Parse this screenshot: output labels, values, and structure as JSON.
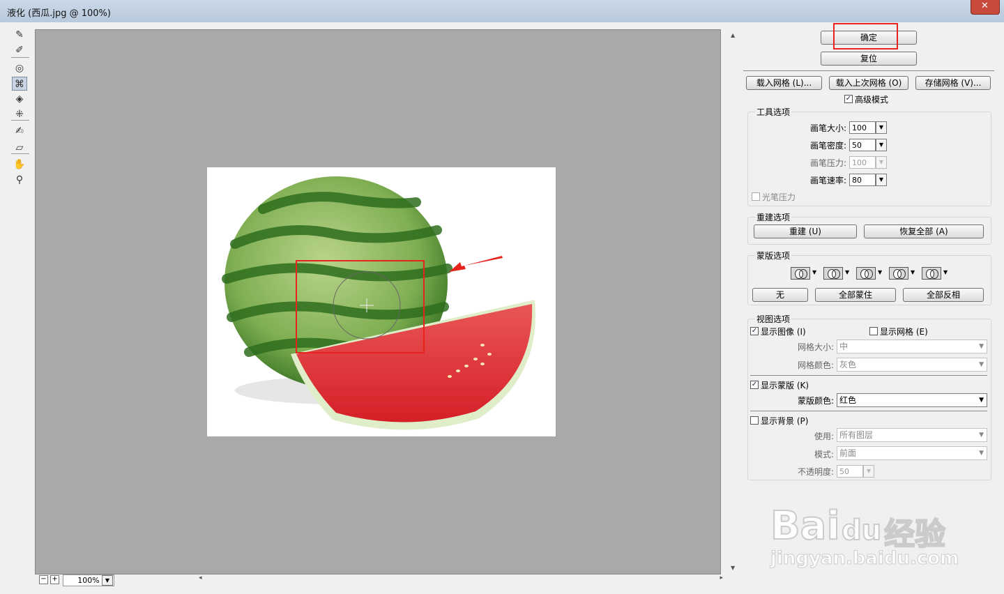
{
  "window": {
    "title": "液化 (西瓜.jpg @ 100%)",
    "close_glyph": "✕"
  },
  "tools": [
    {
      "name": "forward-warp-tool-icon",
      "glyph": "✎"
    },
    {
      "name": "reconstruct-tool-icon",
      "glyph": "✐"
    },
    {
      "name": "twirl-tool-icon",
      "glyph": "◎"
    },
    {
      "name": "pucker-tool-icon",
      "glyph": "⌘"
    },
    {
      "name": "bloat-tool-icon",
      "glyph": "◈"
    },
    {
      "name": "push-left-tool-icon",
      "glyph": "⁜"
    },
    {
      "name": "freeze-mask-tool-icon",
      "glyph": "✍"
    },
    {
      "name": "thaw-mask-tool-icon",
      "glyph": "▱"
    },
    {
      "name": "hand-tool-icon",
      "glyph": "✋"
    },
    {
      "name": "zoom-tool-icon",
      "glyph": "⚲"
    }
  ],
  "status": {
    "zoom": "100%",
    "zoom_out": "−",
    "zoom_in": "+"
  },
  "buttons": {
    "ok": "确定",
    "reset": "复位",
    "load_mesh": "载入网格 (L)...",
    "load_last_mesh": "载入上次网格 (O)",
    "save_mesh": "存储网格 (V)..."
  },
  "advanced_mode": {
    "label": "高级模式",
    "checked": true
  },
  "tool_options": {
    "title": "工具选项",
    "brush_size": {
      "label": "画笔大小:",
      "value": "100"
    },
    "brush_density": {
      "label": "画笔密度:",
      "value": "50"
    },
    "brush_pressure": {
      "label": "画笔压力:",
      "value": "100"
    },
    "brush_rate": {
      "label": "画笔速率:",
      "value": "80"
    },
    "stylus_pressure": {
      "label": "光笔压力",
      "checked": false
    }
  },
  "reconstruct_options": {
    "title": "重建选项",
    "reconstruct": "重建 (U)",
    "restore_all": "恢复全部 (A)"
  },
  "mask_options": {
    "title": "蒙版选项",
    "none": "无",
    "mask_all": "全部蒙住",
    "invert_all": "全部反相"
  },
  "view_options": {
    "title": "视图选项",
    "show_image": {
      "label": "显示图像 (I)",
      "checked": true
    },
    "show_mesh": {
      "label": "显示网格 (E)",
      "checked": false
    },
    "mesh_size": {
      "label": "网格大小:",
      "value": "中"
    },
    "mesh_color": {
      "label": "网格颜色:",
      "value": "灰色"
    },
    "show_mask": {
      "label": "显示蒙版 (K)",
      "checked": true
    },
    "mask_color": {
      "label": "蒙版颜色:",
      "value": "红色"
    },
    "show_backdrop": {
      "label": "显示背景 (P)",
      "checked": false
    },
    "use": {
      "label": "使用:",
      "value": "所有图层"
    },
    "mode": {
      "label": "模式:",
      "value": "前面"
    },
    "opacity": {
      "label": "不透明度:",
      "value": "50"
    }
  },
  "watermark": {
    "brand": "Bai",
    "brand_suffix": "du",
    "brand_cn": "经验",
    "url": "jingyan.baidu.com"
  },
  "check_glyph": "✓",
  "dropdown_glyph": "▼",
  "colors": {
    "highlight": "#e8231b",
    "canvas_bg": "#a9a9a9",
    "watermelon_red": "#e02a2f",
    "rind_green": "#3f8a2c"
  }
}
